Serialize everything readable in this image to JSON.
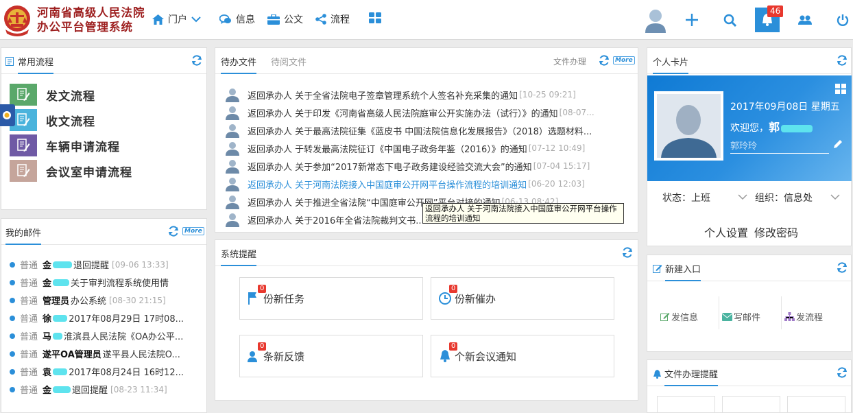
{
  "header": {
    "title_line1": "河南省高级人民法院",
    "title_line2": "办公平台管理系统",
    "nav": [
      {
        "label": "门户"
      },
      {
        "label": "信息"
      },
      {
        "label": "公文"
      },
      {
        "label": "流程"
      }
    ],
    "notification_count": "46"
  },
  "common_flows": {
    "tab": "常用流程",
    "items": [
      {
        "label": "发文流程",
        "color": "#5aa86a"
      },
      {
        "label": "收文流程",
        "color": "#4ab3dc"
      },
      {
        "label": "车辆申请流程",
        "color": "#6f5aa5"
      },
      {
        "label": "会议室申请流程",
        "color": "#c5a59b"
      }
    ]
  },
  "docs": {
    "tab_active": "待办文件",
    "tab_inactive": "待阅文件",
    "handle_label": "文件办理",
    "more": "More",
    "items": [
      {
        "text": "返回承办人  关于全省法院电子签章管理系统个人签名补充采集的通知",
        "time": "[10-25 09:21]"
      },
      {
        "text": "返回承办人  关于印发《河南省高级人民法院庭审公开实施办法（试行）》的通知",
        "time": "[08-07..."
      },
      {
        "text": "返回承办人  关于最高法院征集《蓝皮书 中国法院信息化发展报告》（2018）选题材料...",
        "time": ""
      },
      {
        "text": "返回承办人  于转发最高法院征订《中国电子政务年鉴（2016）》的通知",
        "time": "[07-12 10:49]"
      },
      {
        "text": "返回承办人  关于参加“2017新常态下电子政务建设经验交流大会”的通知",
        "time": "[07-04 15:17]"
      },
      {
        "text": "返回承办人  关于河南法院接入中国庭审公开网平台操作流程的培训通知",
        "time": "[06-20 12:03]"
      },
      {
        "text": "返回承办人  关于推进全省法院“中国庭审公开网”平台对接的通知",
        "time": "[06-13 08:42]"
      },
      {
        "text": "返回承办人  关于2016年全省法院裁判文书...",
        "time": ""
      }
    ],
    "tooltip": "返回承办人   关于河南法院接入中国庭审公开网平台操作流程的培训通知"
  },
  "mail": {
    "tab": "我的邮件",
    "more": "More",
    "items": [
      {
        "priority": "普通",
        "sender": "金",
        "subject": "退回提醒",
        "time": "[09-06 13:33]",
        "blur": 28
      },
      {
        "priority": "普通",
        "sender": "金",
        "subject": "关于审判流程系统使用情",
        "time": "",
        "blur": 24
      },
      {
        "priority": "普通",
        "sender": "管理员",
        "subject": "办公系统",
        "time": "[08-30 21:15]",
        "blur": 0
      },
      {
        "priority": "普通",
        "sender": "徐",
        "subject": "2017年08月29日 17时08...",
        "time": "",
        "blur": 22
      },
      {
        "priority": "普通",
        "sender": "马",
        "subject": "淮滨县人民法院《OA办公平...",
        "time": "",
        "blur": 14
      },
      {
        "priority": "普通",
        "sender": "遂平OA管理员",
        "subject": "遂平县人民法院O...",
        "time": "",
        "blur": 0
      },
      {
        "priority": "普通",
        "sender": "袁",
        "subject": "2017年08月24日 16时12...",
        "time": "",
        "blur": 24
      },
      {
        "priority": "普通",
        "sender": "金",
        "subject": "退回提醒",
        "time": "[08-23 11:34]",
        "blur": 26
      }
    ]
  },
  "reminder": {
    "tab": "系统提醒",
    "items": [
      {
        "count": "0",
        "label": "份新任务",
        "icon": "flag-icon"
      },
      {
        "count": "0",
        "label": "份新催办",
        "icon": "clock-icon"
      },
      {
        "count": "0",
        "label": "条新反馈",
        "icon": "user-feedback-icon"
      },
      {
        "count": "0",
        "label": "个新会议通知",
        "icon": "bell-icon"
      }
    ]
  },
  "profile": {
    "tab": "个人卡片",
    "date": "2017年09月08日 星期五",
    "welcome": "欢迎您，",
    "name_prefix": "郭",
    "signature": "郭玲玲",
    "status": "状态：上班",
    "org": "组织：信息处",
    "settings": "个人设置",
    "change_password": "修改密码"
  },
  "new_entry": {
    "tab": "新建入口",
    "items": [
      {
        "label": "发信息"
      },
      {
        "label": "写邮件"
      },
      {
        "label": "发流程"
      }
    ]
  },
  "file_reminder": {
    "tab": "文件办理提醒"
  }
}
